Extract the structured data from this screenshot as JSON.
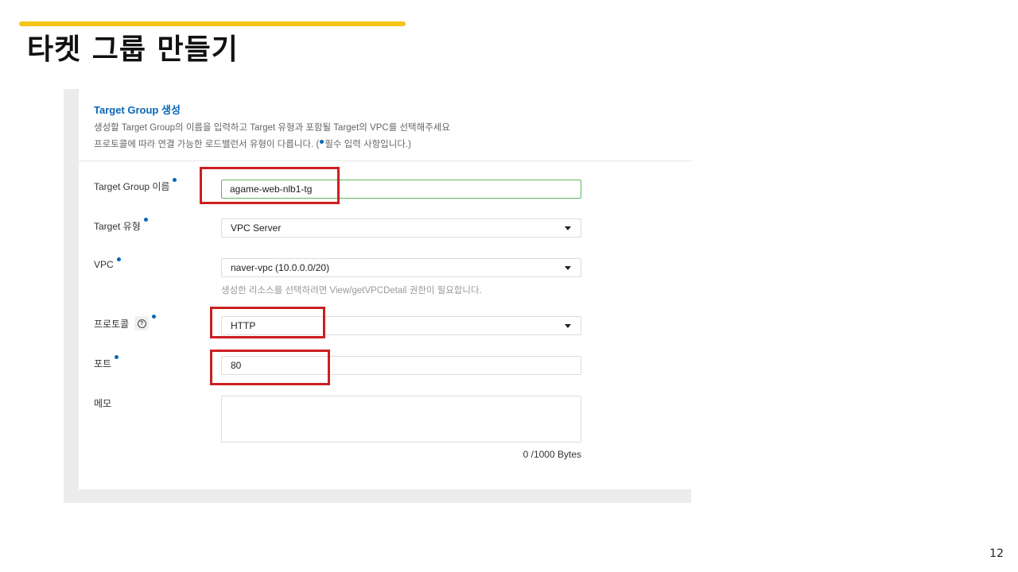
{
  "slide": {
    "title": "타켓 그룹 만들기",
    "page_number": "12"
  },
  "form": {
    "heading": "Target Group 생성",
    "description_line1": "생성할 Target Group의 이름을 입력하고 Target 유형과 포함될 Target의 VPC를 선택해주세요",
    "description_line2_before": "프로토콜에 따라 연결 가능한 로드밸런서 유형이 다릅니다. (",
    "description_line2_after": "필수 입력 사항입니다.)",
    "fields": {
      "name": {
        "label": "Target Group 이름",
        "value": "agame-web-nlb1-tg"
      },
      "target_type": {
        "label": "Target 유형",
        "value": "VPC Server"
      },
      "vpc": {
        "label": "VPC",
        "value": "naver-vpc (10.0.0.0/20)",
        "hint": "생성한 리소스를 선택하려면 View/getVPCDetail 권한이 필요합니다."
      },
      "protocol": {
        "label": "프로토콜",
        "value": "HTTP",
        "help_icon": "question-circle-icon"
      },
      "port": {
        "label": "포트",
        "value": "80"
      },
      "memo": {
        "label": "메모",
        "value": "",
        "counter": "0 /1000 Bytes"
      }
    }
  },
  "colors": {
    "accent": "#f5c518",
    "link_blue": "#0a66b7",
    "required_dot": "#0a66b7",
    "highlight_red": "#cc1f1f",
    "input_focus_green": "#5cb85c"
  }
}
